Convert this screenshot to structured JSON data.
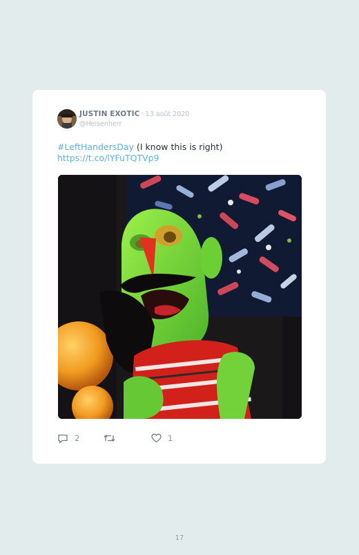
{
  "tweet": {
    "author_name": "JUSTIN EXOTIC",
    "date": "13 août 2020",
    "handle": "@Heisenherr",
    "hashtag": "#LeftHandersDay",
    "text": " (I know this is right)",
    "link": "https://t.co/lYFuTQTVp9",
    "media_icon": "puppet-gif-image",
    "replies": "2",
    "likes": "1"
  },
  "page": {
    "number": "17"
  },
  "colors": {
    "background": "#e3ecec",
    "card": "#ffffff",
    "link": "#5db2e8",
    "muted": "#b8c1c7",
    "author": "#6d7a88"
  },
  "icons": {
    "reply": "speech-bubble-icon",
    "retweet": "retweet-icon",
    "like": "heart-icon"
  }
}
